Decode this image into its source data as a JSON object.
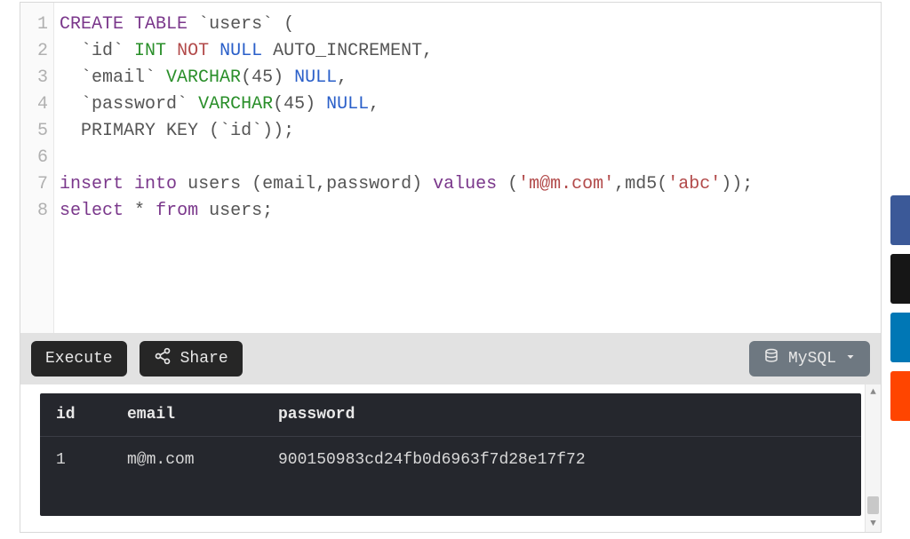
{
  "editor": {
    "line_numbers": [
      "1",
      "2",
      "3",
      "4",
      "5",
      "6",
      "7",
      "8"
    ],
    "code": {
      "l1": {
        "a": "CREATE",
        "b": "TABLE",
        "c": "`users`",
        "d": "("
      },
      "l2": {
        "a": "`id`",
        "b": "INT",
        "c": "NOT",
        "d": "NULL",
        "e": "AUTO_INCREMENT,"
      },
      "l3": {
        "a": "`email`",
        "b": "VARCHAR",
        "c": "(45)",
        "d": "NULL",
        "e": ","
      },
      "l4": {
        "a": "`password`",
        "b": "VARCHAR",
        "c": "(45)",
        "d": "NULL",
        "e": ","
      },
      "l5": {
        "a": "PRIMARY",
        "b": "KEY",
        "c": "(`id`));"
      },
      "l6": "",
      "l7": {
        "a": "insert",
        "b": "into",
        "c": "users (email,password)",
        "d": "values",
        "e": "(",
        "f": "'m@m.com'",
        "g": ",md5(",
        "h": "'abc'",
        "i": "));"
      },
      "l8": {
        "a": "select",
        "b": "*",
        "c": "from",
        "d": "users;"
      }
    }
  },
  "toolbar": {
    "execute_label": "Execute",
    "share_label": "Share",
    "db_label": "MySQL"
  },
  "results": {
    "columns": [
      "id",
      "email",
      "password"
    ],
    "rows": [
      {
        "c0": "1",
        "c1": "m@m.com",
        "c2": "900150983cd24fb0d6963f7d28e17f72"
      }
    ]
  },
  "social": {
    "items": [
      "facebook",
      "twitter",
      "linkedin",
      "reddit"
    ]
  }
}
